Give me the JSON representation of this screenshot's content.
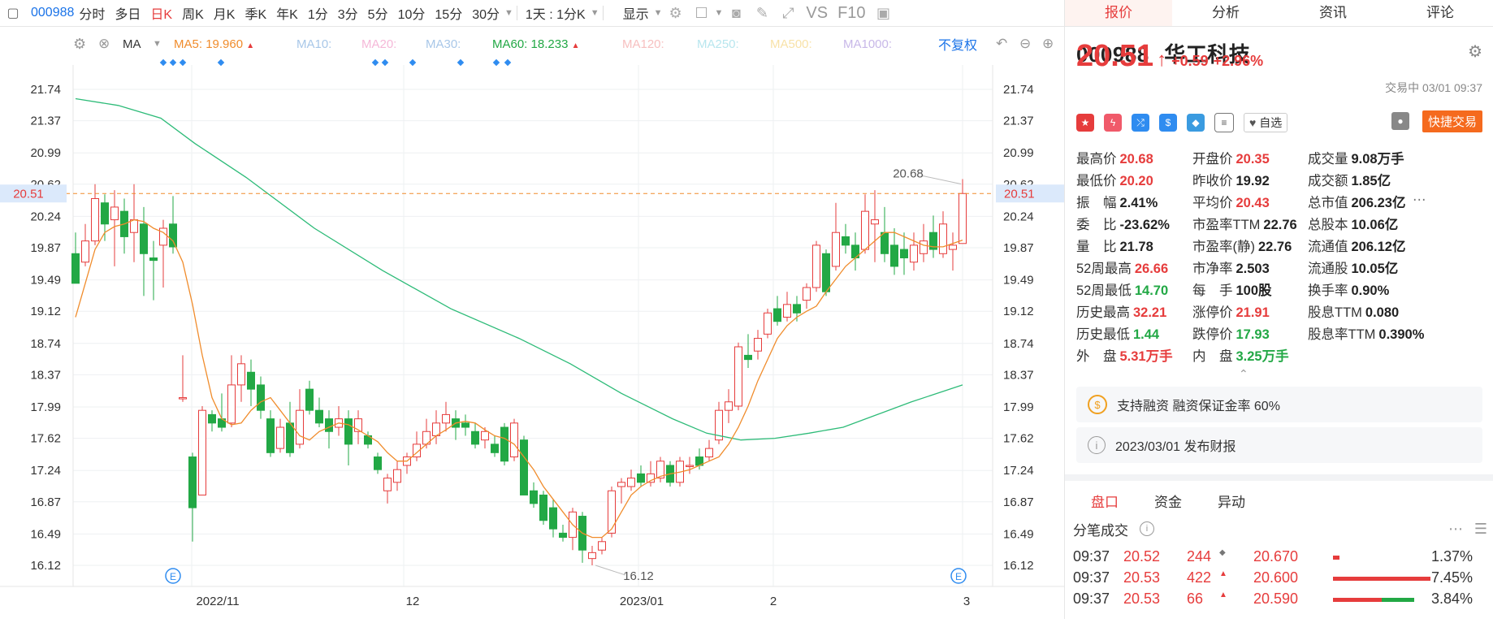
{
  "toolbar": {
    "code": "000988",
    "items": [
      "分时",
      "多日",
      "日K",
      "周K",
      "月K",
      "季K",
      "年K",
      "1分",
      "3分",
      "5分",
      "10分",
      "15分",
      "30分"
    ],
    "active_index": 2,
    "range_select": "1天 : 1分K",
    "display_label": "显示",
    "vs_label": "VS",
    "f10_label": "F10"
  },
  "ma_bar": {
    "ma_label": "MA",
    "ma5_label": "MA5:",
    "ma5_value": "19.960",
    "ma10_label": "MA10:",
    "ma20_label": "MA20:",
    "ma30_label": "MA30:",
    "ma60_label": "MA60:",
    "ma60_value": "18.233",
    "ma120_label": "MA120:",
    "ma250_label": "MA250:",
    "ma500_label": "MA500:",
    "ma1000_label": "MA1000:",
    "fq_label": "不复权"
  },
  "chart_data": {
    "type": "candlestick",
    "y_ticks": [
      "21.74",
      "21.37",
      "20.99",
      "20.62",
      "20.24",
      "19.87",
      "19.49",
      "19.12",
      "18.74",
      "18.37",
      "17.99",
      "17.62",
      "17.24",
      "16.87",
      "16.49",
      "16.12"
    ],
    "ylim": [
      16.12,
      21.74
    ],
    "x_labels": [
      "2022/11",
      "12",
      "2023/01",
      "2",
      "3"
    ],
    "current_price_label": "20.51",
    "high_annotation": "20.68",
    "low_annotation": "16.12",
    "candles": [
      [
        19.8,
        19.45,
        20.05,
        19.45
      ],
      [
        19.7,
        19.95,
        20.15,
        19.65
      ],
      [
        19.95,
        20.45,
        20.62,
        19.9
      ],
      [
        20.4,
        20.15,
        20.5,
        19.95
      ],
      [
        20.2,
        20.35,
        20.55,
        19.65
      ],
      [
        20.3,
        20.0,
        20.45,
        19.8
      ],
      [
        20.05,
        20.2,
        20.62,
        19.7
      ],
      [
        20.15,
        19.8,
        20.35,
        19.3
      ],
      [
        19.75,
        19.72,
        19.95,
        19.25
      ],
      [
        19.9,
        20.1,
        20.2,
        19.4
      ],
      [
        20.15,
        19.88,
        20.48,
        19.8
      ],
      [
        18.1,
        18.1,
        18.6,
        18.05
      ],
      [
        17.4,
        16.8,
        17.45,
        16.4
      ],
      [
        16.95,
        17.95,
        18.0,
        16.95
      ],
      [
        17.9,
        17.8,
        17.95,
        17.7
      ],
      [
        17.85,
        17.75,
        18.15,
        17.7
      ],
      [
        17.8,
        18.25,
        18.6,
        17.75
      ],
      [
        18.25,
        18.5,
        18.6,
        18.05
      ],
      [
        18.4,
        18.2,
        18.55,
        18.0
      ],
      [
        18.25,
        17.95,
        18.35,
        17.85
      ],
      [
        17.85,
        17.45,
        17.95,
        17.4
      ],
      [
        17.5,
        17.75,
        17.85,
        17.45
      ],
      [
        17.8,
        17.45,
        18.05,
        17.4
      ],
      [
        17.55,
        17.95,
        18.2,
        17.5
      ],
      [
        18.2,
        17.95,
        18.3,
        17.9
      ],
      [
        17.95,
        17.8,
        18.1,
        17.75
      ],
      [
        17.85,
        17.7,
        17.95,
        17.5
      ],
      [
        17.75,
        17.85,
        18.0,
        17.65
      ],
      [
        17.85,
        17.55,
        17.95,
        17.3
      ],
      [
        17.7,
        17.85,
        17.95,
        17.55
      ],
      [
        17.65,
        17.55,
        17.7,
        17.5
      ],
      [
        17.4,
        17.25,
        17.45,
        17.2
      ],
      [
        17.0,
        17.15,
        17.2,
        16.85
      ],
      [
        17.1,
        17.25,
        17.35,
        17.0
      ],
      [
        17.3,
        17.4,
        17.45,
        17.2
      ],
      [
        17.4,
        17.55,
        17.7,
        17.35
      ],
      [
        17.55,
        17.7,
        17.85,
        17.5
      ],
      [
        17.65,
        17.8,
        17.95,
        17.55
      ],
      [
        17.8,
        17.9,
        18.05,
        17.7
      ],
      [
        17.85,
        17.75,
        17.95,
        17.6
      ],
      [
        17.8,
        17.75,
        17.9,
        17.65
      ],
      [
        17.7,
        17.55,
        17.8,
        17.5
      ],
      [
        17.6,
        17.7,
        17.75,
        17.5
      ],
      [
        17.55,
        17.45,
        17.65,
        17.4
      ],
      [
        17.75,
        17.35,
        17.8,
        17.3
      ],
      [
        17.4,
        17.8,
        17.85,
        17.35
      ],
      [
        17.6,
        16.95,
        17.65,
        16.95
      ],
      [
        17.0,
        16.85,
        17.1,
        16.8
      ],
      [
        16.95,
        16.65,
        17.0,
        16.6
      ],
      [
        16.8,
        16.55,
        16.9,
        16.45
      ],
      [
        16.5,
        16.45,
        16.6,
        16.4
      ],
      [
        16.45,
        16.75,
        16.8,
        16.3
      ],
      [
        16.7,
        16.3,
        16.75,
        16.15
      ],
      [
        16.2,
        16.27,
        16.35,
        16.12
      ],
      [
        16.3,
        16.4,
        16.45,
        16.25
      ],
      [
        16.5,
        17.0,
        17.05,
        16.45
      ],
      [
        17.05,
        17.1,
        17.15,
        16.85
      ],
      [
        17.05,
        17.15,
        17.25,
        17.0
      ],
      [
        17.2,
        17.1,
        17.3,
        17.05
      ],
      [
        17.1,
        17.2,
        17.35,
        17.05
      ],
      [
        17.15,
        17.35,
        17.4,
        17.1
      ],
      [
        17.3,
        17.1,
        17.35,
        17.05
      ],
      [
        17.1,
        17.35,
        17.4,
        17.05
      ],
      [
        17.3,
        17.3,
        17.4,
        17.2
      ],
      [
        17.4,
        17.3,
        17.5,
        17.25
      ],
      [
        17.4,
        17.5,
        17.6,
        17.35
      ],
      [
        17.6,
        17.95,
        18.05,
        17.55
      ],
      [
        17.95,
        18.05,
        18.2,
        17.8
      ],
      [
        18.0,
        18.7,
        18.75,
        17.95
      ],
      [
        18.6,
        18.55,
        18.85,
        18.45
      ],
      [
        18.65,
        18.8,
        18.9,
        18.55
      ],
      [
        18.85,
        19.1,
        19.15,
        18.8
      ],
      [
        19.15,
        19.0,
        19.3,
        18.95
      ],
      [
        19.05,
        19.2,
        19.35,
        19.0
      ],
      [
        19.2,
        19.1,
        19.3,
        19.0
      ],
      [
        19.25,
        19.4,
        19.45,
        19.15
      ],
      [
        19.4,
        19.9,
        19.95,
        19.35
      ],
      [
        19.8,
        19.35,
        19.85,
        19.3
      ],
      [
        19.65,
        20.05,
        20.4,
        19.6
      ],
      [
        20.0,
        19.9,
        20.15,
        19.8
      ],
      [
        19.9,
        19.75,
        20.05,
        19.6
      ],
      [
        19.85,
        20.3,
        20.5,
        19.8
      ],
      [
        20.15,
        20.2,
        20.55,
        19.7
      ],
      [
        20.05,
        19.8,
        20.35,
        19.7
      ],
      [
        19.9,
        19.65,
        20.1,
        19.55
      ],
      [
        19.85,
        19.75,
        20.05,
        19.55
      ],
      [
        19.7,
        19.9,
        20.05,
        19.6
      ],
      [
        19.8,
        19.95,
        20.15,
        19.7
      ],
      [
        20.05,
        19.85,
        20.25,
        19.75
      ],
      [
        19.8,
        20.15,
        20.3,
        19.75
      ],
      [
        19.85,
        19.9,
        20.05,
        19.6
      ],
      [
        19.92,
        20.51,
        20.68,
        20.2
      ]
    ],
    "ma5_values": [
      19.05,
      19.45,
      19.85,
      20.05,
      20.12,
      20.15,
      20.2,
      20.18,
      20.1,
      20.05,
      19.95,
      19.7,
      19.2,
      18.6,
      18.1,
      17.85,
      17.78,
      17.8,
      17.95,
      18.05,
      18.1,
      17.95,
      17.8,
      17.65,
      17.6,
      17.7,
      17.75,
      17.8,
      17.78,
      17.72,
      17.65,
      17.58,
      17.45,
      17.35,
      17.35,
      17.45,
      17.55,
      17.65,
      17.72,
      17.8,
      17.82,
      17.8,
      17.72,
      17.65,
      17.62,
      17.55,
      17.4,
      17.25,
      17.05,
      16.9,
      16.75,
      16.6,
      16.5,
      16.45,
      16.45,
      16.55,
      16.75,
      16.95,
      17.05,
      17.12,
      17.17,
      17.2,
      17.22,
      17.25,
      17.3,
      17.35,
      17.4,
      17.55,
      17.75,
      18.0,
      18.3,
      18.55,
      18.8,
      18.95,
      19.05,
      19.12,
      19.18,
      19.35,
      19.5,
      19.65,
      19.75,
      19.85,
      19.95,
      20.05,
      20.05,
      20.0,
      19.95,
      19.9,
      19.88,
      19.88,
      19.92,
      19.96
    ]
  },
  "ma60_line_points": [
    [
      0,
      21.63
    ],
    [
      5,
      21.55
    ],
    [
      10,
      21.4
    ],
    [
      14,
      21.1
    ],
    [
      20,
      20.7
    ],
    [
      28,
      20.1
    ],
    [
      36,
      19.6
    ],
    [
      44,
      19.15
    ],
    [
      52,
      18.8
    ],
    [
      58,
      18.5
    ],
    [
      64,
      18.15
    ],
    [
      70,
      17.85
    ],
    [
      74,
      17.68
    ],
    [
      78,
      17.6
    ],
    [
      82,
      17.62
    ],
    [
      86,
      17.68
    ],
    [
      90,
      17.75
    ],
    [
      94,
      17.9
    ],
    [
      98,
      18.05
    ],
    [
      104,
      18.25
    ]
  ],
  "right": {
    "tabs": [
      "报价",
      "分析",
      "资讯",
      "评论"
    ],
    "active_tab": 0,
    "code": "000988",
    "name": "华工科技",
    "price": "20.51",
    "change": "+0.59",
    "change_pct": "+2.96%",
    "trade_time": "交易中 03/01 09:37",
    "fav_label": "自选",
    "quick_trade": "快捷交易",
    "stats": [
      [
        [
          "最高价",
          "20.68",
          "up"
        ],
        [
          "开盘价",
          "20.35",
          "up"
        ],
        [
          "成交量",
          "9.08万手",
          "neu"
        ]
      ],
      [
        [
          "最低价",
          "20.20",
          "up"
        ],
        [
          "昨收价",
          "19.92",
          "neu"
        ],
        [
          "成交额",
          "1.85亿",
          "neu"
        ]
      ],
      [
        [
          "振　幅",
          "2.41%",
          "neu"
        ],
        [
          "平均价",
          "20.43",
          "up"
        ],
        [
          "总市值",
          "206.23亿",
          "neu"
        ]
      ],
      [
        [
          "委　比",
          "-23.62%",
          "neu"
        ],
        [
          "市盈率TTM",
          "22.76",
          "neu"
        ],
        [
          "总股本",
          "10.06亿",
          "neu"
        ]
      ],
      [
        [
          "量　比",
          "21.78",
          "neu"
        ],
        [
          "市盈率(静)",
          "22.76",
          "neu"
        ],
        [
          "流通值",
          "206.12亿",
          "neu"
        ]
      ],
      [
        [
          "52周最高",
          "26.66",
          "up"
        ],
        [
          "市净率",
          "2.503",
          "neu"
        ],
        [
          "流通股",
          "10.05亿",
          "neu"
        ]
      ],
      [
        [
          "52周最低",
          "14.70",
          "down"
        ],
        [
          "每　手",
          "100股",
          "neu"
        ],
        [
          "换手率",
          "0.90%",
          "neu"
        ]
      ],
      [
        [
          "历史最高",
          "32.21",
          "up"
        ],
        [
          "涨停价",
          "21.91",
          "up"
        ],
        [
          "股息TTM",
          "0.080",
          "neu"
        ]
      ],
      [
        [
          "历史最低",
          "1.44",
          "down"
        ],
        [
          "跌停价",
          "17.93",
          "down"
        ],
        [
          "股息率TTM",
          "0.390%",
          "neu"
        ]
      ],
      [
        [
          "外　盘",
          "5.31万手",
          "up"
        ],
        [
          "内　盘",
          "3.25万手",
          "down"
        ],
        [
          "",
          ""
        ]
      ]
    ],
    "notice1": "支持融资 融资保证金率 60%",
    "notice2": "2023/03/01  发布财报",
    "sub_tabs": [
      "盘口",
      "资金",
      "异动"
    ],
    "ticks_title": "分笔成交",
    "ticks": [
      {
        "time": "09:37",
        "price": "20.52",
        "vol": "244",
        "px2": "20.670",
        "pct": "1.37%"
      },
      {
        "time": "09:37",
        "price": "20.53",
        "vol": "422",
        "px2": "20.600",
        "pct": "7.45%"
      },
      {
        "time": "09:37",
        "price": "20.53",
        "vol": "66",
        "px2": "20.590",
        "pct": "3.84%"
      }
    ]
  }
}
